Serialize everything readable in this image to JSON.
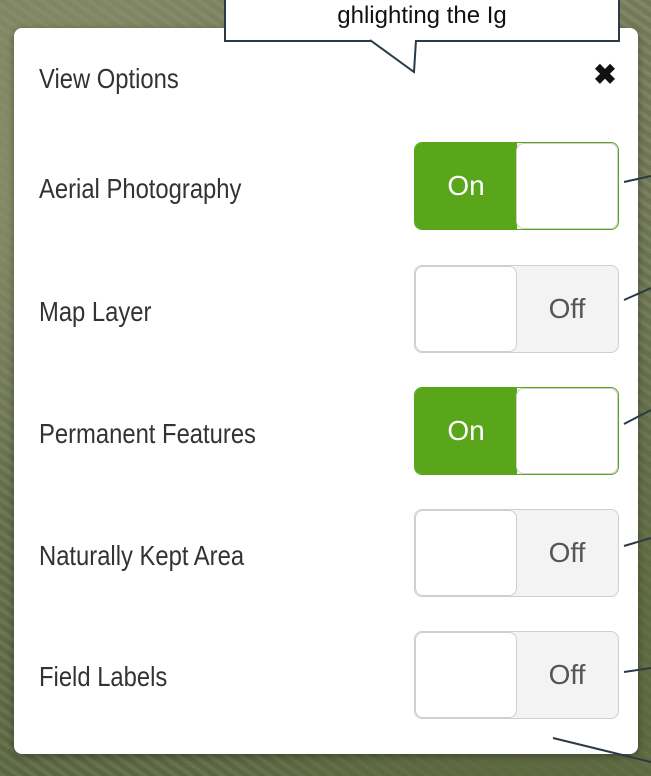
{
  "callout": {
    "text": "ghlighting the Ig"
  },
  "panel": {
    "title": "View Options",
    "close_label": "✖",
    "options": [
      {
        "label": "Aerial Photography",
        "state": "On",
        "on": true
      },
      {
        "label": "Map Layer",
        "state": "Off",
        "on": false
      },
      {
        "label": "Permanent Features",
        "state": "On",
        "on": true
      },
      {
        "label": "Naturally Kept Area",
        "state": "Off",
        "on": false
      },
      {
        "label": "Field Labels",
        "state": "Off",
        "on": false
      }
    ]
  },
  "colors": {
    "toggle_on": "#5aa61b",
    "background": "aerial-photo"
  },
  "icons": {
    "close": "close-icon"
  }
}
